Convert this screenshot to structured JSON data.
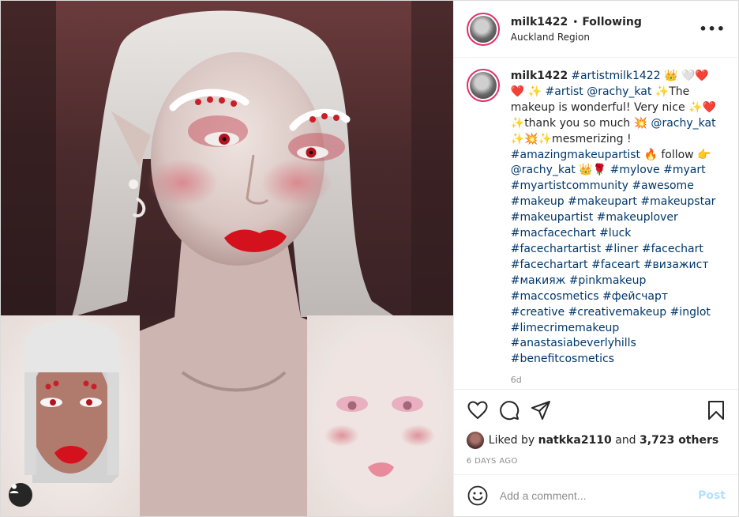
{
  "post": {
    "author": {
      "username": "milk1422",
      "follow_status": "Following",
      "location": "Auckland Region",
      "more_icon": "more-options-icon"
    },
    "caption": {
      "username": "milk1422",
      "segments": [
        {
          "type": "tag",
          "text": "#artistmilk1422"
        },
        {
          "type": "text",
          "text": " 👑 🤍❤️ ❤️ ✨ "
        },
        {
          "type": "tag",
          "text": "#artist"
        },
        {
          "type": "text",
          "text": " "
        },
        {
          "type": "tag",
          "text": "@rachy_kat"
        },
        {
          "type": "text",
          "text": " ✨The makeup is wonderful! Very nice ✨❤️ ✨thank you so much 💥 "
        },
        {
          "type": "tag",
          "text": "@rachy_kat"
        },
        {
          "type": "text",
          "text": " ✨💥✨mesmerizing ! "
        },
        {
          "type": "tag",
          "text": "#amazingmakeupartist"
        },
        {
          "type": "text",
          "text": " 🔥 follow 👉 "
        },
        {
          "type": "tag",
          "text": "@rachy_kat"
        },
        {
          "type": "text",
          "text": " 👑🌹 "
        },
        {
          "type": "tag",
          "text": "#mylove"
        },
        {
          "type": "text",
          "text": " "
        },
        {
          "type": "tag",
          "text": "#myart"
        },
        {
          "type": "text",
          "text": " "
        },
        {
          "type": "tag",
          "text": "#myartistcommunity"
        },
        {
          "type": "text",
          "text": " "
        },
        {
          "type": "tag",
          "text": "#awesome"
        },
        {
          "type": "text",
          "text": " "
        },
        {
          "type": "tag",
          "text": "#makeup"
        },
        {
          "type": "text",
          "text": " "
        },
        {
          "type": "tag",
          "text": "#makeupart"
        },
        {
          "type": "text",
          "text": " "
        },
        {
          "type": "tag",
          "text": "#makeupstar"
        },
        {
          "type": "text",
          "text": " "
        },
        {
          "type": "tag",
          "text": "#makeupartist"
        },
        {
          "type": "text",
          "text": " "
        },
        {
          "type": "tag",
          "text": "#makeuplover"
        },
        {
          "type": "text",
          "text": " "
        },
        {
          "type": "tag",
          "text": "#macfacechart"
        },
        {
          "type": "text",
          "text": " "
        },
        {
          "type": "tag",
          "text": "#luck"
        },
        {
          "type": "text",
          "text": " "
        },
        {
          "type": "tag",
          "text": "#facechartartist"
        },
        {
          "type": "text",
          "text": " "
        },
        {
          "type": "tag",
          "text": "#liner"
        },
        {
          "type": "text",
          "text": " "
        },
        {
          "type": "tag",
          "text": "#facechart"
        },
        {
          "type": "text",
          "text": " "
        },
        {
          "type": "tag",
          "text": "#facechartart"
        },
        {
          "type": "text",
          "text": " "
        },
        {
          "type": "tag",
          "text": "#faceart"
        },
        {
          "type": "text",
          "text": " "
        },
        {
          "type": "tag",
          "text": "#визажист"
        },
        {
          "type": "text",
          "text": " "
        },
        {
          "type": "tag",
          "text": "#макияж"
        },
        {
          "type": "text",
          "text": " "
        },
        {
          "type": "tag",
          "text": "#pinkmakeup"
        },
        {
          "type": "text",
          "text": " "
        },
        {
          "type": "tag",
          "text": "#maccosmetics"
        },
        {
          "type": "text",
          "text": " "
        },
        {
          "type": "tag",
          "text": "#фейсчарт"
        },
        {
          "type": "text",
          "text": " "
        },
        {
          "type": "tag",
          "text": "#creative"
        },
        {
          "type": "text",
          "text": " "
        },
        {
          "type": "tag",
          "text": "#creativemakeup"
        },
        {
          "type": "text",
          "text": " "
        },
        {
          "type": "tag",
          "text": "#inglot"
        },
        {
          "type": "text",
          "text": " "
        },
        {
          "type": "tag",
          "text": "#limecrimemakeup"
        },
        {
          "type": "text",
          "text": " "
        },
        {
          "type": "tag",
          "text": "#anastasiabeverlyhills"
        },
        {
          "type": "text",
          "text": " "
        },
        {
          "type": "tag",
          "text": "#benefitcosmetics"
        }
      ],
      "time_stub": "6d"
    },
    "actions": {
      "like_icon": "heart-icon",
      "comment_icon": "comment-icon",
      "share_icon": "share-icon",
      "save_icon": "bookmark-icon"
    },
    "likes": {
      "prefix": "Liked by",
      "first_user": "natkka2110",
      "joiner": "and",
      "others": "3,723 others"
    },
    "date": "6 DAYS AGO",
    "comment_input": {
      "placeholder": "Add a comment...",
      "post_label": "Post",
      "emoji_icon": "smiley-icon"
    }
  },
  "colors": {
    "link": "#00376b",
    "muted": "#8e8e8e",
    "post_disabled": "#b2dffc",
    "ring": "#e1306c"
  }
}
